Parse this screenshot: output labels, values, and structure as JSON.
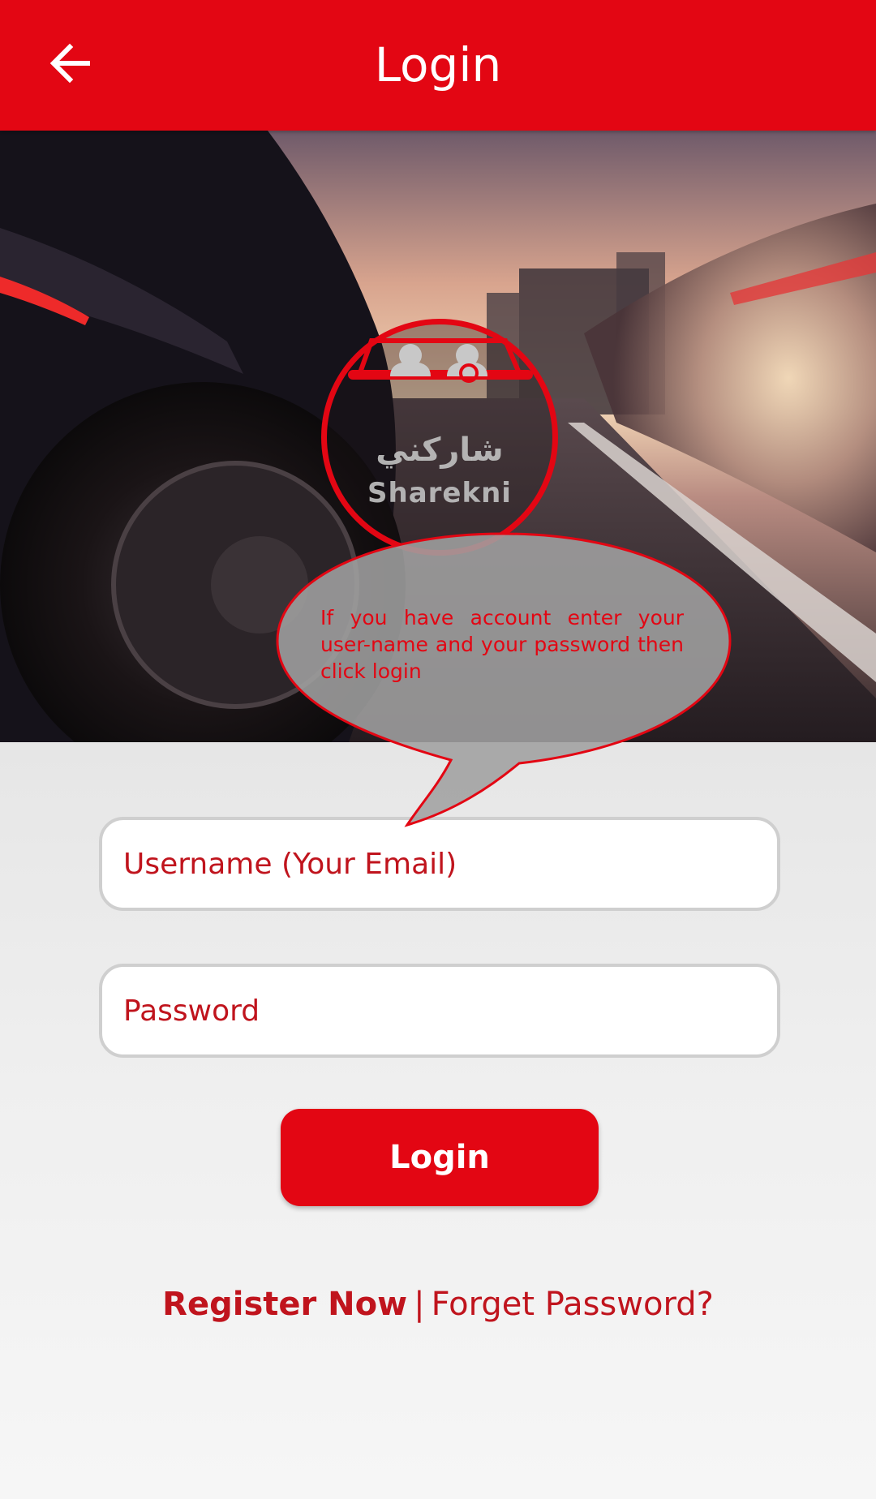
{
  "app_bar": {
    "title": "Login",
    "back_icon": "arrow-left-icon",
    "background_color": "#e30613"
  },
  "logo": {
    "arabic_text": "شاركني",
    "latin_text": "Sharekni"
  },
  "tooltip": {
    "text": "If you have account enter your user-name and your password then click login"
  },
  "form": {
    "username_placeholder": "Username (Your Email)",
    "password_placeholder": "Password",
    "login_label": "Login"
  },
  "links": {
    "register_label": "Register Now",
    "separator": "|",
    "forgot_label": "Forget Password?"
  },
  "colors": {
    "accent": "#e30613",
    "text_red": "#c0141d",
    "field_border": "#cfcfcf"
  }
}
